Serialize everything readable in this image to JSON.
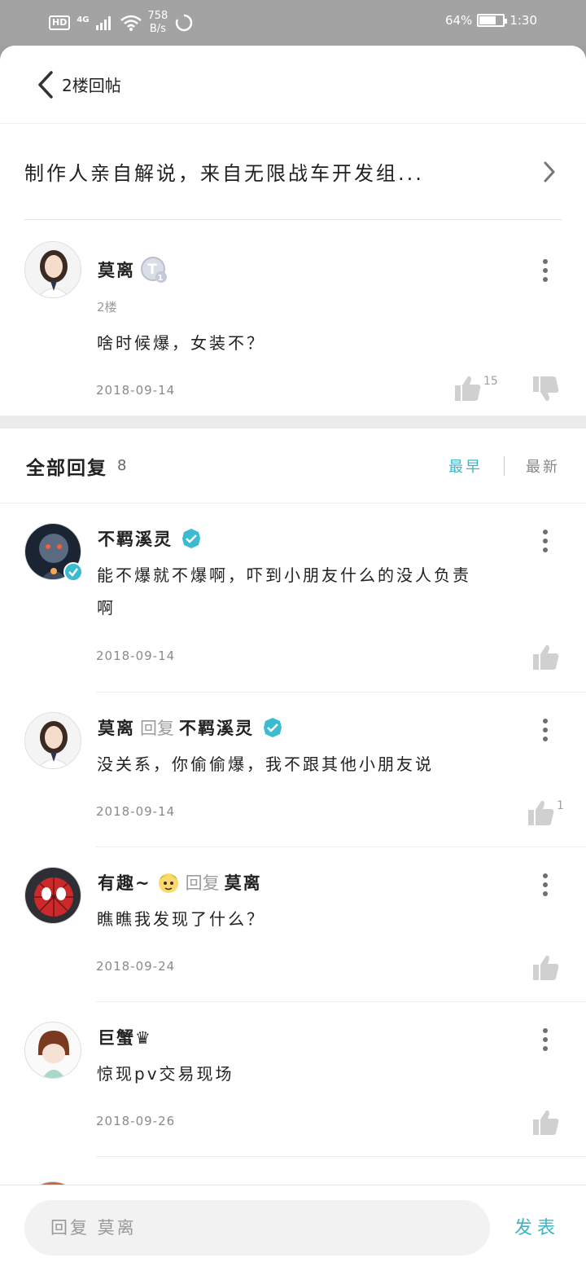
{
  "status_bar": {
    "hd": "HD",
    "network": "4G",
    "speed_value": "758",
    "speed_unit": "B/s",
    "battery_percent": "64%",
    "battery_level": 0.64,
    "time": "1:30"
  },
  "header": {
    "title": "2楼回帖"
  },
  "topic": {
    "text": "制作人亲自解说，来自无限战车开发组..."
  },
  "main_post": {
    "author": "莫离",
    "floor": "2楼",
    "content": "啥时候爆，女装不？",
    "date": "2018-09-14",
    "likes": "15"
  },
  "replies_header": {
    "title": "全部回复",
    "count": "8",
    "sort_earliest": "最早",
    "sort_latest": "最新"
  },
  "replies": [
    {
      "author": "不羁溪灵",
      "content_line1": "能不爆就不爆啊，吓到小朋友什么的没人负责",
      "content_line2": "啊",
      "date": "2018-09-14",
      "likes": ""
    },
    {
      "author": "莫离",
      "reply_word": "回复",
      "target": "不羁溪灵",
      "content": "没关系，你偷偷爆，我不跟其他小朋友说",
      "date": "2018-09-14",
      "likes": "1"
    },
    {
      "author": "有趣~",
      "reply_word": "回复",
      "target": "莫离",
      "content": "瞧瞧我发现了什么？",
      "date": "2018-09-24",
      "likes": ""
    },
    {
      "author": "巨蟹♛",
      "content": "惊现pv交易现场",
      "date": "2018-09-26",
      "likes": ""
    }
  ],
  "bottom_bar": {
    "input_placeholder": "回复 莫离",
    "send_label": "发表"
  },
  "colors": {
    "accent": "#3bb5c6",
    "verified": "#3bbbd0"
  }
}
